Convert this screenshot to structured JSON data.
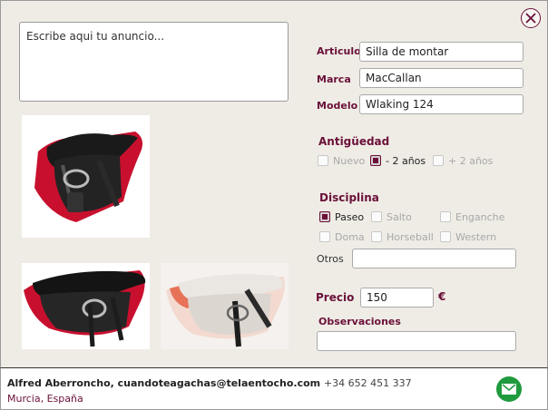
{
  "ad": {
    "placeholder": "Escribe aqui tu anuncio..."
  },
  "fields": {
    "articulo": {
      "label": "Articulo",
      "value": "Silla de montar"
    },
    "marca": {
      "label": "Marca",
      "value": "MacCallan"
    },
    "modelo": {
      "label": "Modelo",
      "value": "Wlaking 124"
    }
  },
  "antiguedad": {
    "title": "Antigüedad",
    "options": [
      {
        "label": "Nuevo",
        "checked": false
      },
      {
        "label": "- 2 años",
        "checked": true
      },
      {
        "label": "+ 2 años",
        "checked": false
      }
    ]
  },
  "disciplina": {
    "title": "Disciplina",
    "options": [
      {
        "label": "Paseo",
        "checked": true
      },
      {
        "label": "Salto",
        "checked": false
      },
      {
        "label": "Enganche",
        "checked": false
      },
      {
        "label": "Doma",
        "checked": false
      },
      {
        "label": "Horseball",
        "checked": false
      },
      {
        "label": "Western",
        "checked": false
      }
    ]
  },
  "otros": {
    "label": "Otros",
    "value": ""
  },
  "precio": {
    "label": "Precio",
    "value": "150",
    "currency": "€"
  },
  "observaciones": {
    "label": "Observaciones",
    "value": ""
  },
  "footer": {
    "contact": "Alfred Aberroncho, cuandoteagachas@telaentocho.com",
    "phone": "+34 652 451 337",
    "location": "Murcia, España"
  },
  "icons": {
    "close": "close-icon",
    "mail": "mail-icon"
  },
  "colors": {
    "accent": "#6a1038",
    "mail_button": "#1f9a3e",
    "panel_bg": "#efece6"
  }
}
